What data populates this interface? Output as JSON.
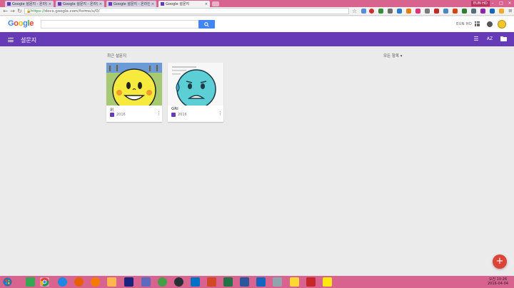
{
  "browser": {
    "tabs": [
      {
        "label": "Google 설문지 - 온라인...",
        "active": false
      },
      {
        "label": "Google 설문지 - 온라인...",
        "active": false
      },
      {
        "label": "Google 설문지 - 온라인...",
        "active": false
      },
      {
        "label": "Google 설문지",
        "active": true
      }
    ],
    "user_chip": "EUN HO",
    "url_secure": "https://",
    "url_rest": "docs.google.com/forms/u/0/"
  },
  "google_bar": {
    "logo": [
      "G",
      "o",
      "o",
      "g",
      "l",
      "e"
    ],
    "logo_colors": [
      "#4285f4",
      "#ea4335",
      "#fbbc05",
      "#4285f4",
      "#34a853",
      "#ea4335"
    ],
    "search_value": "",
    "username": "EUN HO"
  },
  "app": {
    "title": "설문지",
    "section_label": "최근 설문지",
    "filter_label": "모든 항목 ▾",
    "accent": "#673ab7"
  },
  "forms": [
    {
      "name": "위",
      "date": "2016",
      "thumb": "yellow-smiley"
    },
    {
      "name": "GRI",
      "date": "2016",
      "thumb": "blue-sweating-face"
    }
  ],
  "clock": {
    "time": "오전 10:26",
    "date": "2016-04-04"
  },
  "fab": {
    "label": "+"
  }
}
